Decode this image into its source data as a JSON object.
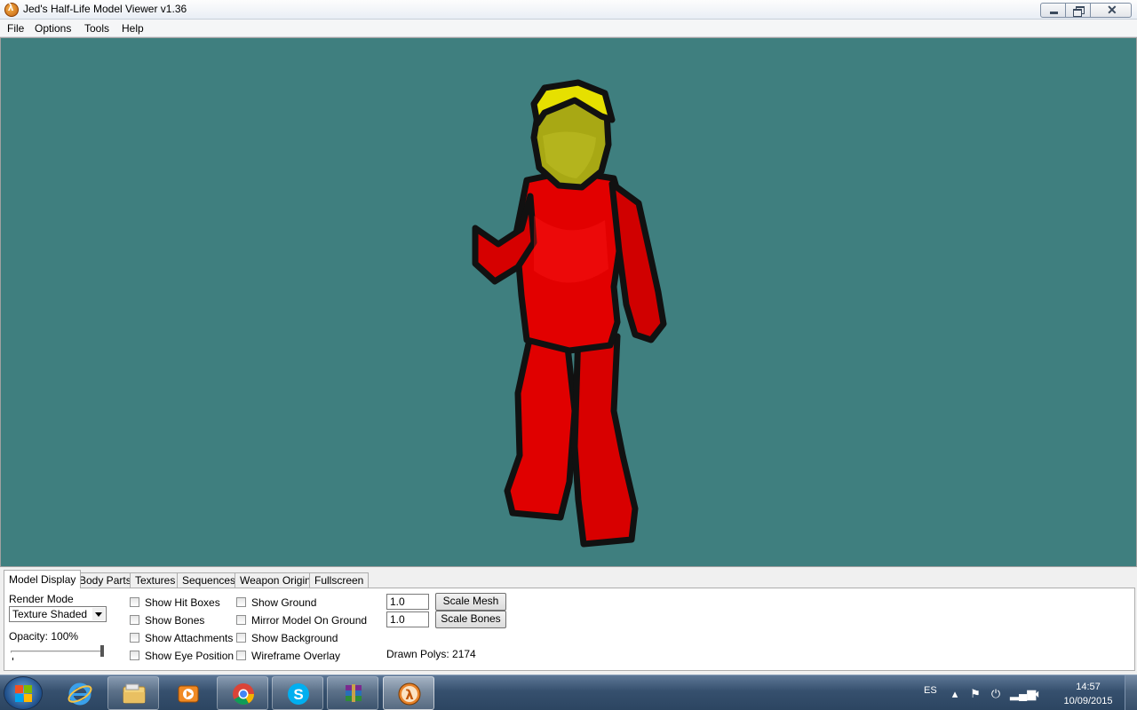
{
  "window": {
    "title": "Jed's Half-Life Model Viewer v1.36",
    "icon": "half-life-lambda-icon"
  },
  "menu": {
    "items": [
      "File",
      "Options",
      "Tools",
      "Help"
    ]
  },
  "viewport": {
    "background_color": "#3f7f7f",
    "model_colors": {
      "body": "#e00000",
      "head": "#a7a712",
      "hair": "#e6e000",
      "outline": "#111111"
    }
  },
  "tabs": [
    "Model Display",
    "Body Parts",
    "Textures",
    "Sequences",
    "Weapon Origin",
    "Fullscreen"
  ],
  "active_tab": "Model Display",
  "model_display": {
    "render_mode_label": "Render Mode",
    "render_mode_value": "Texture Shaded",
    "opacity_label": "Opacity: 100%",
    "opacity_value": 1.0,
    "checkboxes_col1": [
      "Show Hit Boxes",
      "Show Bones",
      "Show Attachments",
      "Show Eye Position"
    ],
    "checkboxes_col2": [
      "Show Ground",
      "Mirror Model On Ground",
      "Show Background",
      "Wireframe Overlay"
    ],
    "scale_mesh_value": "1.0",
    "scale_mesh_button": "Scale Mesh",
    "scale_bones_value": "1.0",
    "scale_bones_button": "Scale Bones",
    "drawn_polys": "Drawn Polys: 2174"
  },
  "taskbar": {
    "items": [
      {
        "name": "internet-explorer-icon"
      },
      {
        "name": "windows-explorer-icon"
      },
      {
        "name": "media-player-icon"
      },
      {
        "name": "chrome-icon"
      },
      {
        "name": "skype-icon"
      },
      {
        "name": "winrar-icon"
      },
      {
        "name": "half-life-model-viewer-icon"
      }
    ],
    "language": "ES",
    "time": "14:57",
    "date": "10/09/2015"
  }
}
